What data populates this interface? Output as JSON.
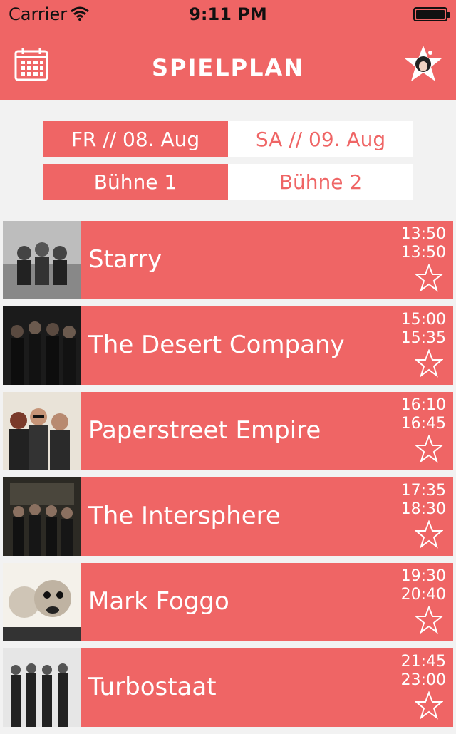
{
  "status": {
    "carrier": "Carrier",
    "time": "9:11 PM"
  },
  "nav": {
    "title": "SPIELPLAN"
  },
  "days": [
    {
      "label": "FR // 08. Aug",
      "active": true
    },
    {
      "label": "SA // 09. Aug",
      "active": false
    }
  ],
  "stages": [
    {
      "label": "Bühne 1",
      "active": true
    },
    {
      "label": "Bühne 2",
      "active": false
    }
  ],
  "acts": [
    {
      "name": "Starry",
      "start": "13:50",
      "end": "13:50"
    },
    {
      "name": "The Desert Company",
      "start": "15:00",
      "end": "15:35"
    },
    {
      "name": "Paperstreet Empire",
      "start": "16:10",
      "end": "16:45"
    },
    {
      "name": "The Intersphere",
      "start": "17:35",
      "end": "18:30"
    },
    {
      "name": "Mark Foggo",
      "start": "19:30",
      "end": "20:40"
    },
    {
      "name": "Turbostaat",
      "start": "21:45",
      "end": "23:00"
    }
  ],
  "colors": {
    "accent": "#ef6565",
    "background": "#f2f2f2"
  }
}
